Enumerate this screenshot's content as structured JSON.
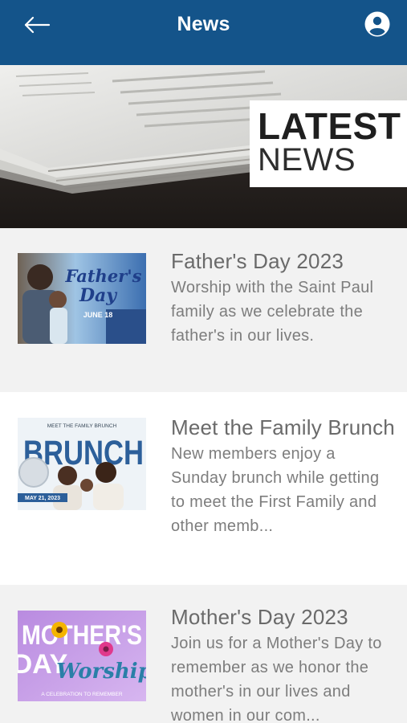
{
  "header": {
    "title": "News",
    "back_icon": "arrow-left-icon",
    "profile_icon": "user-circle-icon",
    "bar_color": "#14548a"
  },
  "hero": {
    "line1": "LATEST",
    "line2": "NEWS"
  },
  "news": [
    {
      "title": "Father's Day 2023",
      "description": "Worship with the Saint Paul family as we celebrate the father's in our lives.",
      "thumb": {
        "line1": "Father's",
        "line2": "Day",
        "date": "JUNE 18"
      }
    },
    {
      "title": "Meet the Family Brunch",
      "description": "New members enjoy a Sunday brunch while getting to meet the First Family and other memb...",
      "thumb": {
        "top": "MEET THE FAMILY BRUNCH",
        "word": "BRUNCH",
        "date": "MAY 21, 2023"
      }
    },
    {
      "title": "Mother's Day 2023",
      "description": "Join us for a Mother's Day to remember as we honor the mother's in our lives and women in our com...",
      "thumb": {
        "line1": "MOTHER'S",
        "line2": "DAY",
        "script": "Worship",
        "tag": "A CELEBRATION TO REMEMBER"
      }
    }
  ]
}
